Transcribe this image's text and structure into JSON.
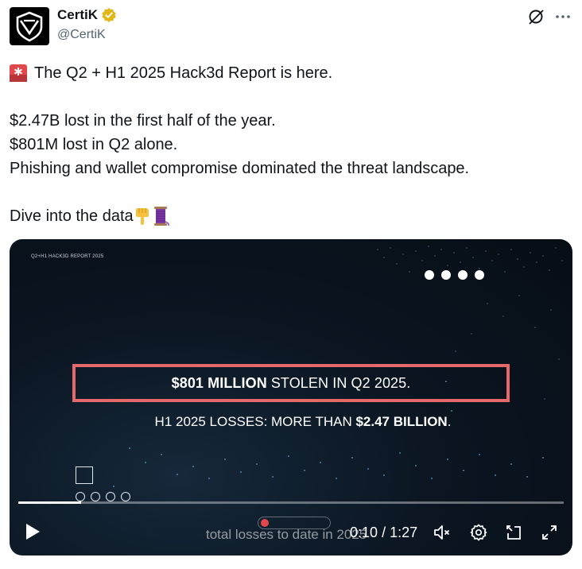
{
  "author": {
    "name": "CertiK",
    "handle": "@CertiK",
    "verified": true,
    "badge_color": "#e2b719"
  },
  "header_icons": [
    "grok-icon",
    "more-icon"
  ],
  "tweet": {
    "line1": "The Q2 + H1 2025 Hack3d Report is here.",
    "line2": "$2.47B lost in the first half of the year.",
    "line3": "$801M lost in Q2 alone.",
    "line4": "Phishing and wallet compromise dominated the threat landscape.",
    "line5": "Dive into the data",
    "emojis": [
      "siren-icon",
      "pointing-down-icon",
      "thread-spool-icon"
    ]
  },
  "video": {
    "report_label": "Q2+H1 HACK3D REPORT 2025",
    "headline_bold": "$801 MILLION",
    "headline_rest": "STOLEN IN Q2 2025.",
    "subline_start": "H1 2025 LOSSES: MORE THAN",
    "subline_bold": "$2.47 BILLION",
    "subline_end": ".",
    "caption_text": "total losses to date in 2025",
    "current_time": "0:10",
    "time_separator": "/",
    "duration": "1:27",
    "progress_fraction": 0.115,
    "accent_red": "#e5686a",
    "controls": [
      "play-icon",
      "mute-icon",
      "settings-icon",
      "pip-icon",
      "fullscreen-icon"
    ]
  }
}
